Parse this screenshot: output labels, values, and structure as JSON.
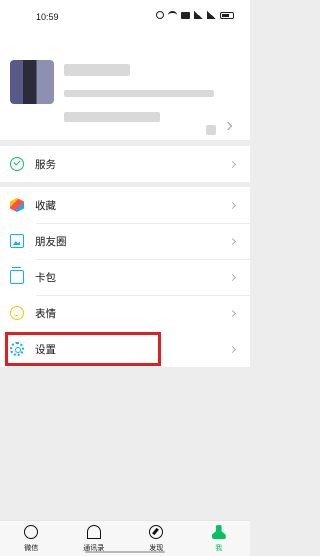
{
  "status_bar": {
    "time": "10:59",
    "icons": [
      "alarm-icon",
      "wifi-icon",
      "hd-icon",
      "signal-icon",
      "signal-icon",
      "battery-icon"
    ],
    "battery_level_percent": 70
  },
  "profile": {
    "avatar": "avatar-blurred",
    "name": "",
    "wechat_id": ""
  },
  "menu": {
    "group1": [
      {
        "label": "服务",
        "icon": "service-icon"
      }
    ],
    "group2": [
      {
        "label": "收藏",
        "icon": "favorites-icon"
      },
      {
        "label": "朋友圈",
        "icon": "moments-icon"
      },
      {
        "label": "卡包",
        "icon": "cards-wallet-icon"
      },
      {
        "label": "表情",
        "icon": "emoji-icon"
      }
    ],
    "group3": [
      {
        "label": "设置",
        "icon": "settings-gear-icon",
        "highlighted": true
      }
    ]
  },
  "tabbar": {
    "tabs": [
      {
        "label": "微信",
        "icon": "chat-icon",
        "active": false
      },
      {
        "label": "通讯录",
        "icon": "contacts-icon",
        "active": false
      },
      {
        "label": "发现",
        "icon": "discover-compass-icon",
        "active": false
      },
      {
        "label": "我",
        "icon": "me-person-icon",
        "active": true
      }
    ]
  },
  "colors": {
    "accent": "#07c160",
    "highlight_box": "#e02020",
    "background": "#ededed"
  }
}
